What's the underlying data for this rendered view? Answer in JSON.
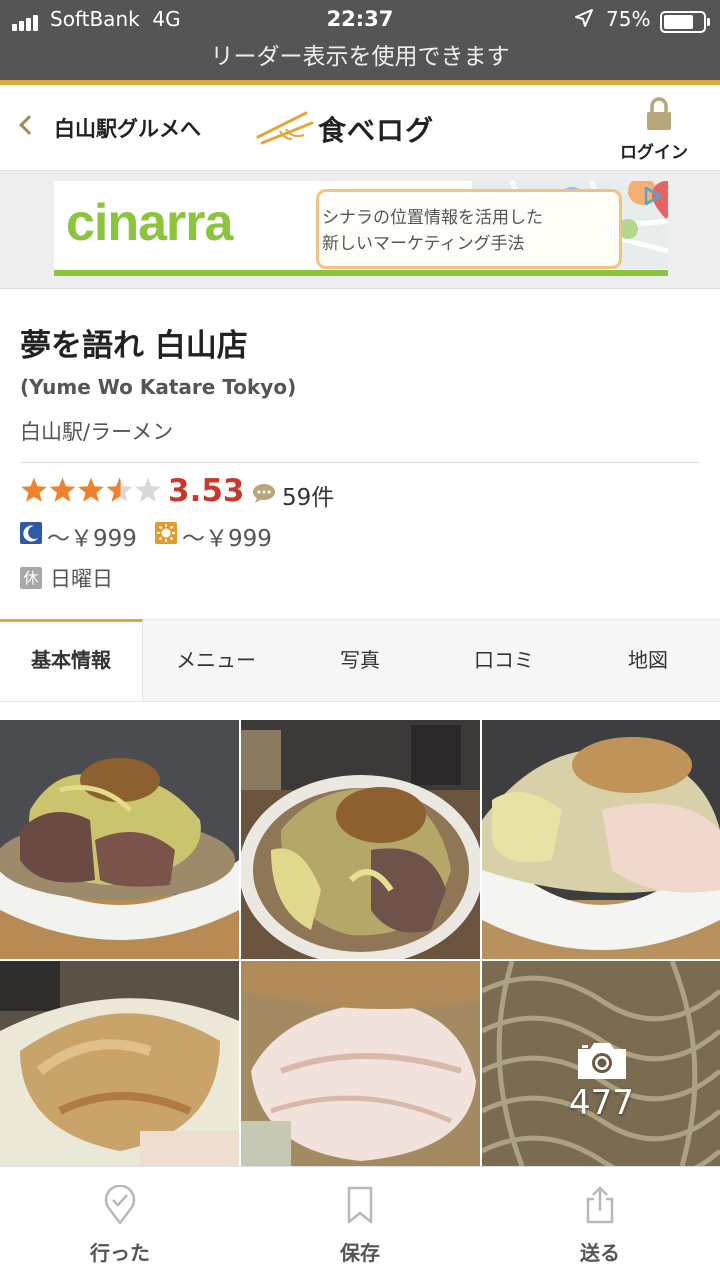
{
  "status_bar": {
    "carrier": "SoftBank",
    "network": "4G",
    "time": "22:37",
    "battery": "75%",
    "reader_notice": "リーダー表示を使用できます"
  },
  "header": {
    "back_label": "白山駅グルメへ",
    "logo": "食べログ",
    "login_label": "ログイン"
  },
  "ad": {
    "brand": "cinarra",
    "line1": "シナラの位置情報を活用した",
    "line2": "新しいマーケティング手法"
  },
  "shop": {
    "name": "夢を語れ 白山店",
    "roman_name": "(Yume Wo Katare Tokyo)",
    "genre": "白山駅/ラーメン",
    "rating": "3.53",
    "rating_value": 3.53,
    "review_count": "59件",
    "dinner_price": "～￥999",
    "lunch_price": "～￥999",
    "holiday_badge": "休",
    "holiday": "日曜日"
  },
  "tabs": [
    {
      "label": "基本情報",
      "active": true
    },
    {
      "label": "メニュー",
      "active": false
    },
    {
      "label": "写真",
      "active": false
    },
    {
      "label": "口コミ",
      "active": false
    },
    {
      "label": "地図",
      "active": false
    }
  ],
  "photos": {
    "count": "477"
  },
  "bottom_nav": {
    "went_label": "行った",
    "save_label": "保存",
    "share_label": "送る"
  },
  "colors": {
    "status_bg": "#555555",
    "brand_gold": "#d8ac45",
    "rating_red": "#c8392b",
    "star_orange": "#f0812e",
    "ad_green": "#8bc53f"
  }
}
